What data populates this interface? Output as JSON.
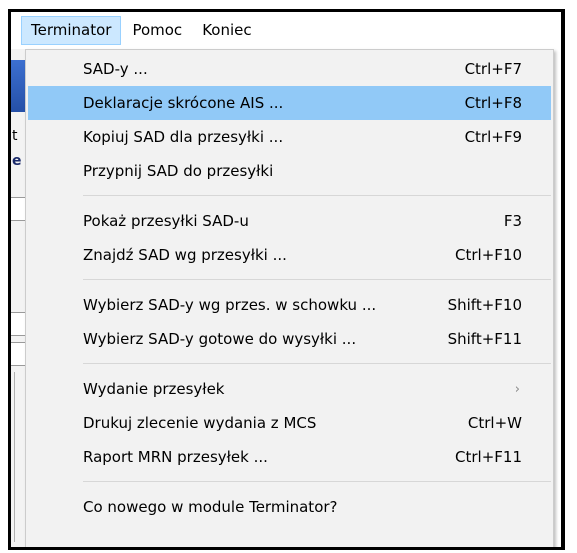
{
  "menubar": {
    "items": [
      {
        "label": "Terminator",
        "active": true
      },
      {
        "label": "Pomoc",
        "active": false
      },
      {
        "label": "Koniec",
        "active": false
      }
    ]
  },
  "background": {
    "frag_t": "t",
    "frag_e": "e"
  },
  "menu": {
    "items": [
      {
        "label": "SAD-y ...",
        "shortcut": "Ctrl+F7"
      },
      {
        "label": "Deklaracje skrócone AIS ...",
        "shortcut": "Ctrl+F8",
        "highlighted": true
      },
      {
        "label": "Kopiuj SAD dla przesyłki ...",
        "shortcut": "Ctrl+F9"
      },
      {
        "label": "Przypnij SAD do przesyłki",
        "shortcut": ""
      },
      {
        "label": "Pokaż przesyłki SAD-u",
        "shortcut": "F3"
      },
      {
        "label": "Znajdź SAD wg przesyłki ...",
        "shortcut": "Ctrl+F10"
      },
      {
        "label": "Wybierz SAD-y wg przes. w schowku ...",
        "shortcut": "Shift+F10"
      },
      {
        "label": "Wybierz SAD-y gotowe do wysyłki ...",
        "shortcut": "Shift+F11"
      },
      {
        "label": "Wydanie przesyłek",
        "shortcut": "",
        "submenu_arrow": "›"
      },
      {
        "label": "Drukuj zlecenie wydania z MCS",
        "shortcut": "Ctrl+W"
      },
      {
        "label": "Raport MRN przesyłek ...",
        "shortcut": "Ctrl+F11"
      },
      {
        "label": "Co nowego w module Terminator?",
        "shortcut": ""
      }
    ]
  },
  "colors": {
    "highlight": "#91c9f7",
    "menu_background": "#f2f2f2",
    "menubar_active": "#cce8ff"
  }
}
